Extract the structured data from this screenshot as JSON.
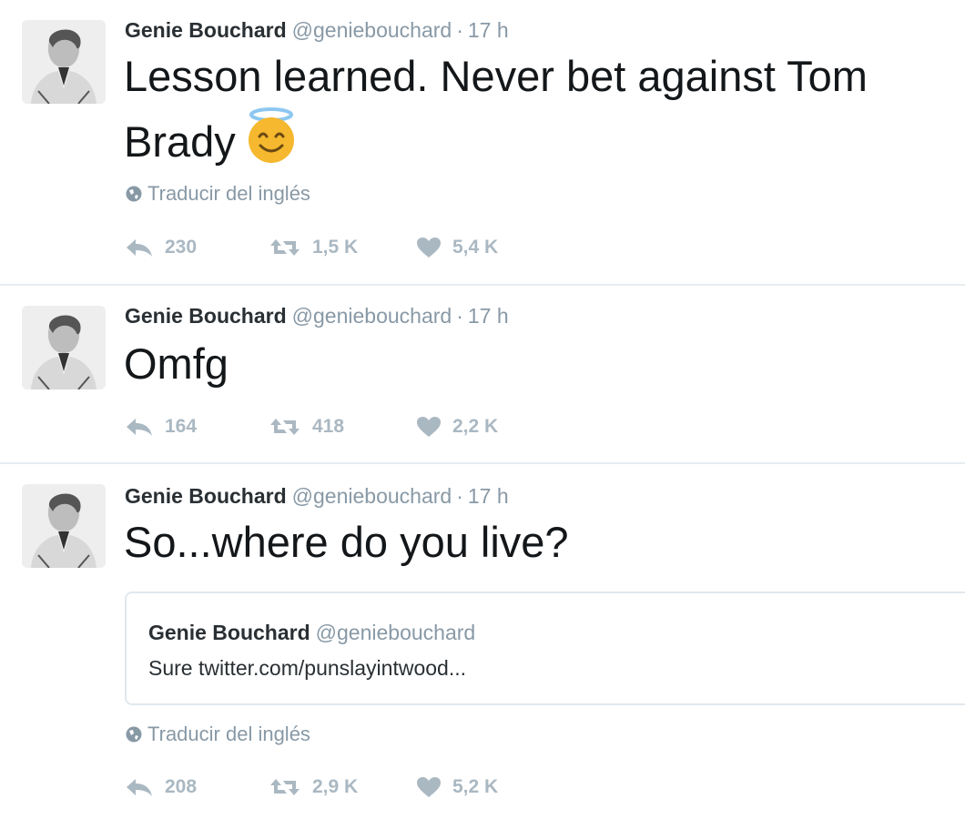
{
  "tweets": [
    {
      "author": "Genie Bouchard",
      "handle": "@geniebouchard",
      "separator": "·",
      "time": "17 h",
      "text": "Lesson learned. Never bet against Tom Brady",
      "emoji": "smiling-face-with-halo",
      "translate": "Traducir del inglés",
      "replies": "230",
      "retweets": "1,5 K",
      "likes": "5,4 K"
    },
    {
      "author": "Genie Bouchard",
      "handle": "@geniebouchard",
      "separator": "·",
      "time": "17 h",
      "text": "Omfg",
      "replies": "164",
      "retweets": "418",
      "likes": "2,2 K"
    },
    {
      "author": "Genie Bouchard",
      "handle": "@geniebouchard",
      "separator": "·",
      "time": "17 h",
      "text": "So...where do you live?",
      "quote": {
        "author": "Genie Bouchard",
        "handle": "@geniebouchard",
        "text": "Sure twitter.com/punslayintwood..."
      },
      "translate": "Traducir del inglés",
      "replies": "208",
      "retweets": "2,9 K",
      "likes": "5,2 K"
    }
  ],
  "icons": {
    "reply": "reply-icon",
    "retweet": "retweet-icon",
    "like": "heart-icon",
    "translate": "globe-icon"
  },
  "colors": {
    "text": "#14171a",
    "muted": "#8899a6",
    "action": "#aab8c2",
    "divider": "#e6ecf0",
    "emoji": "#f5b82e"
  }
}
